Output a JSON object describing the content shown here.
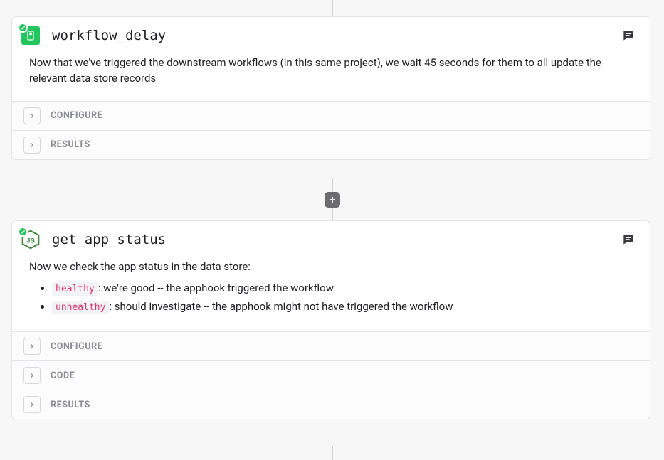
{
  "step1": {
    "title": "workflow_delay",
    "description": "Now that we've triggered the downstream workflows (in this same project), we wait 45 seconds for them to all update the relevant data store records",
    "sections": {
      "configure": "CONFIGURE",
      "results": "RESULTS"
    }
  },
  "step2": {
    "title": "get_app_status",
    "intro": "Now we check the app status in the data store:",
    "bullets": {
      "healthy_chip": "healthy",
      "healthy_text": ": we're good -- the apphook triggered the workflow",
      "unhealthy_chip": "unhealthy",
      "unhealthy_text": ": should investigate -- the apphook might not have triggered the workflow"
    },
    "sections": {
      "configure": "CONFIGURE",
      "code": "CODE",
      "results": "RESULTS"
    }
  }
}
